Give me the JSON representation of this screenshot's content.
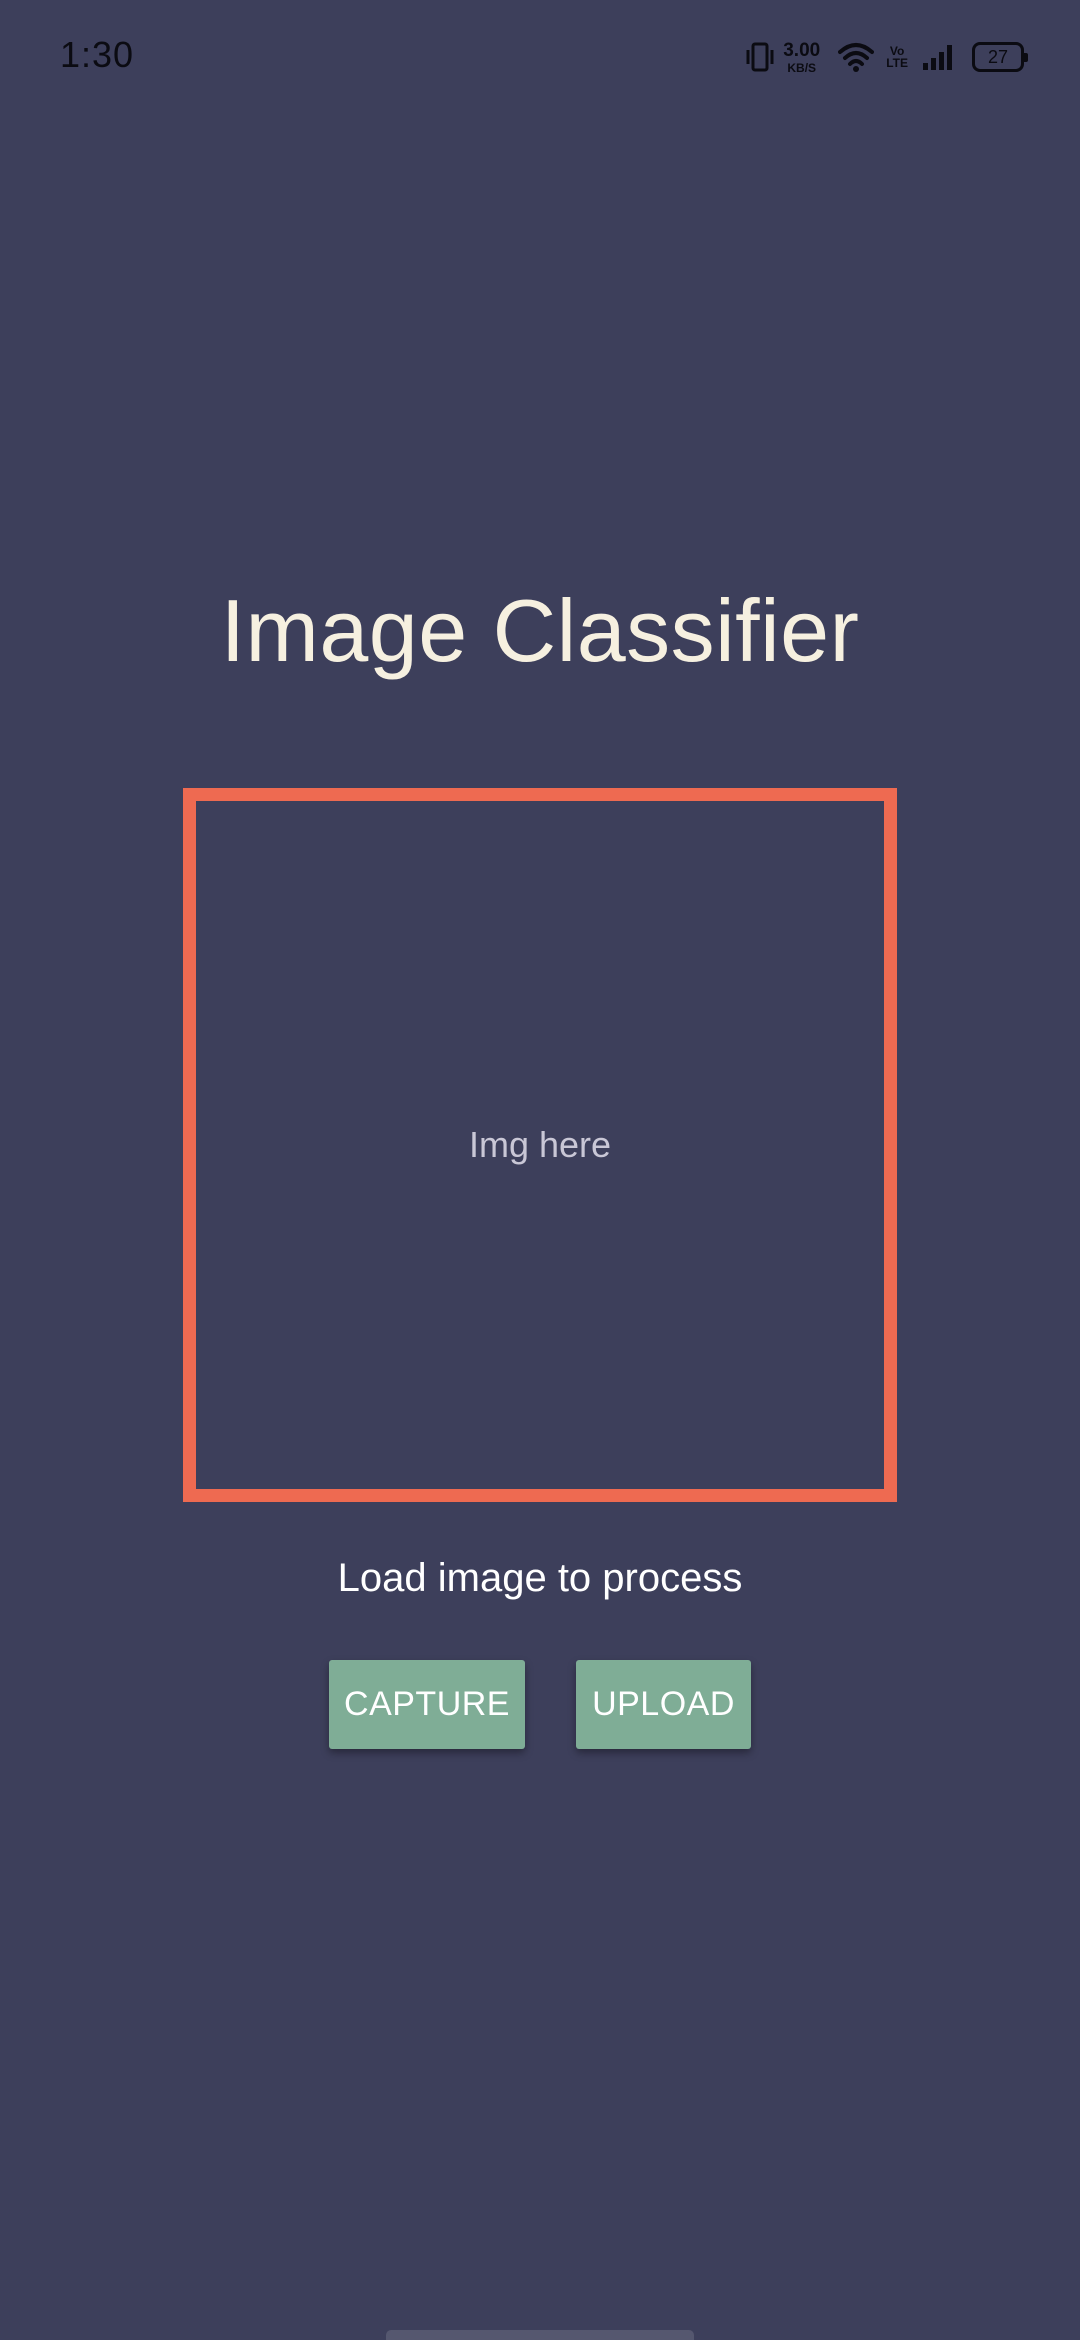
{
  "status_bar": {
    "time": "1:30",
    "net_speed_value": "3.00",
    "net_speed_unit": "KB/S",
    "volte_top": "Vo",
    "volte_bottom": "LTE",
    "battery_level": "27",
    "icons": [
      "vibrate-icon",
      "wifi-icon",
      "volte-icon",
      "signal-icon",
      "battery-icon"
    ]
  },
  "main": {
    "title": "Image Classifier",
    "image_placeholder": "Img here",
    "status_text": "Load image to process",
    "capture_label": "CAPTURE",
    "upload_label": "UPLOAD"
  },
  "colors": {
    "background": "#3d3f5b",
    "frame_border": "#ee6a51",
    "button": "#7fad96",
    "title": "#f6f0e0"
  }
}
